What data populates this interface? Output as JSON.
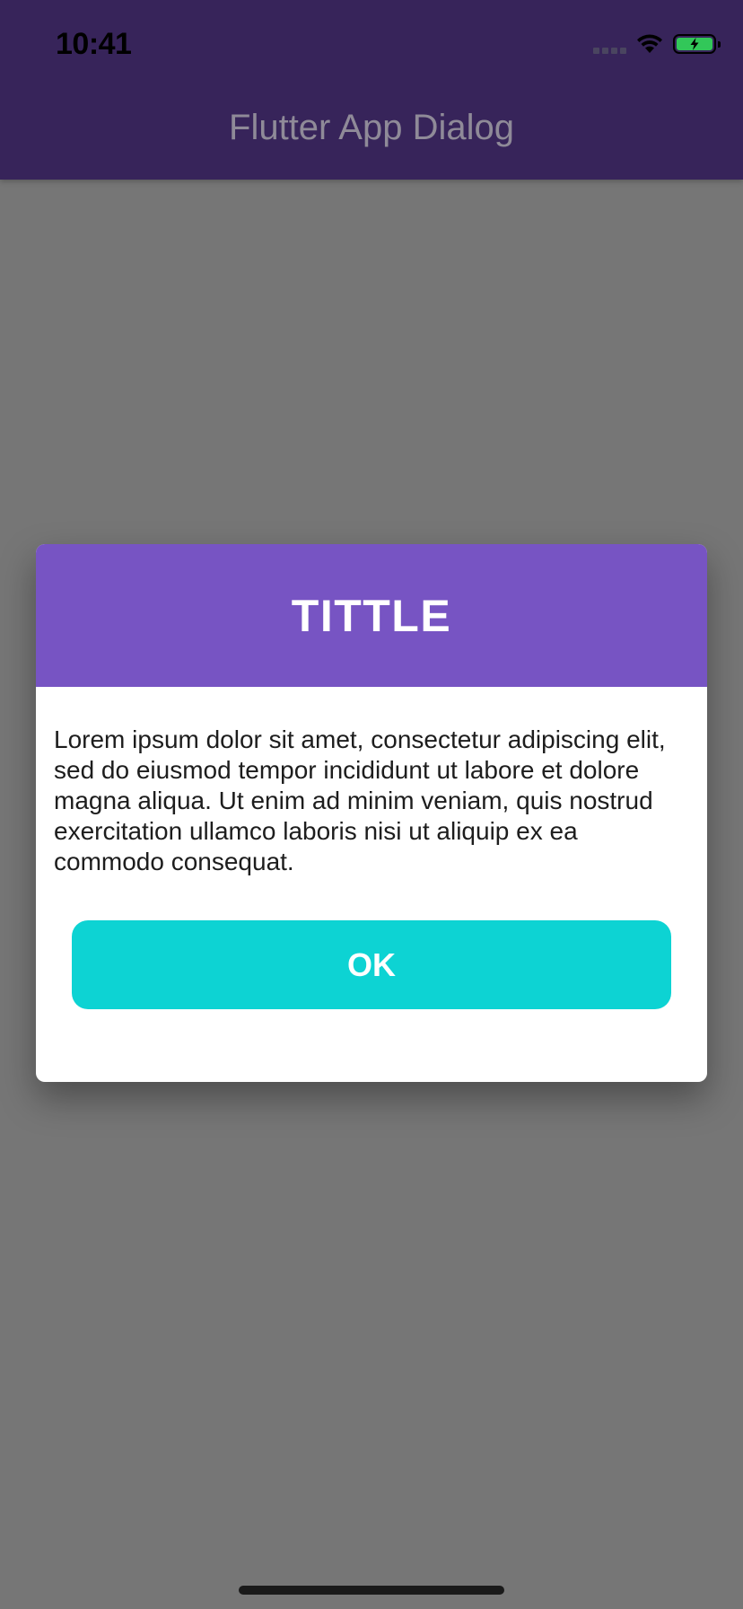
{
  "status_bar": {
    "time": "10:41"
  },
  "app_bar": {
    "title": "Flutter App Dialog"
  },
  "dialog": {
    "title": "TITTLE",
    "message": "Lorem ipsum dolor sit amet, consectetur adipiscing elit, sed do eiusmod tempor incididunt ut labore et dolore magna aliqua. Ut enim ad minim veniam, quis nostrud exercitation ullamco laboris nisi ut aliquip ex ea commodo consequat.",
    "ok_label": "OK"
  },
  "colors": {
    "app_bar": "#37245a",
    "dialog_header": "#7754c3",
    "ok_button": "#0dd3d3",
    "barrier": "#767676",
    "battery": "#32c759"
  },
  "icons": [
    "cellular-signal-icon",
    "wifi-icon",
    "battery-charging-icon"
  ]
}
